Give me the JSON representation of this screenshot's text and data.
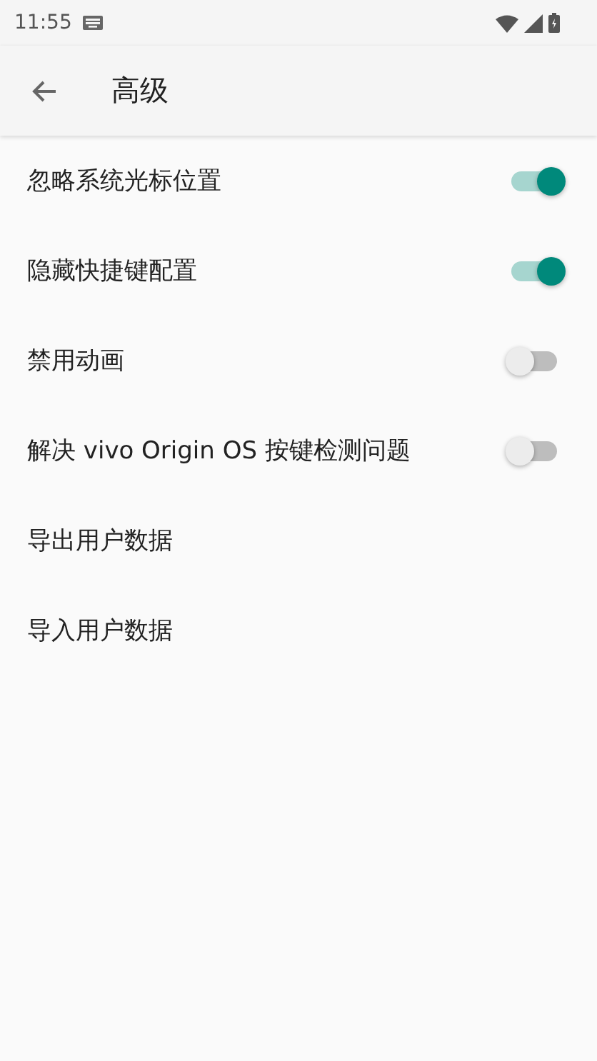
{
  "status_bar": {
    "time": "11:55"
  },
  "toolbar": {
    "title": "高级"
  },
  "settings": [
    {
      "kind": "switch",
      "label": "忽略系统光标位置",
      "on": true
    },
    {
      "kind": "switch",
      "label": "隐藏快捷键配置",
      "on": true
    },
    {
      "kind": "switch",
      "label": "禁用动画",
      "on": false
    },
    {
      "kind": "switch",
      "label": "解决 vivo Origin OS 按键检测问题",
      "on": false
    },
    {
      "kind": "action",
      "label": "导出用户数据"
    },
    {
      "kind": "action",
      "label": "导入用户数据"
    }
  ]
}
